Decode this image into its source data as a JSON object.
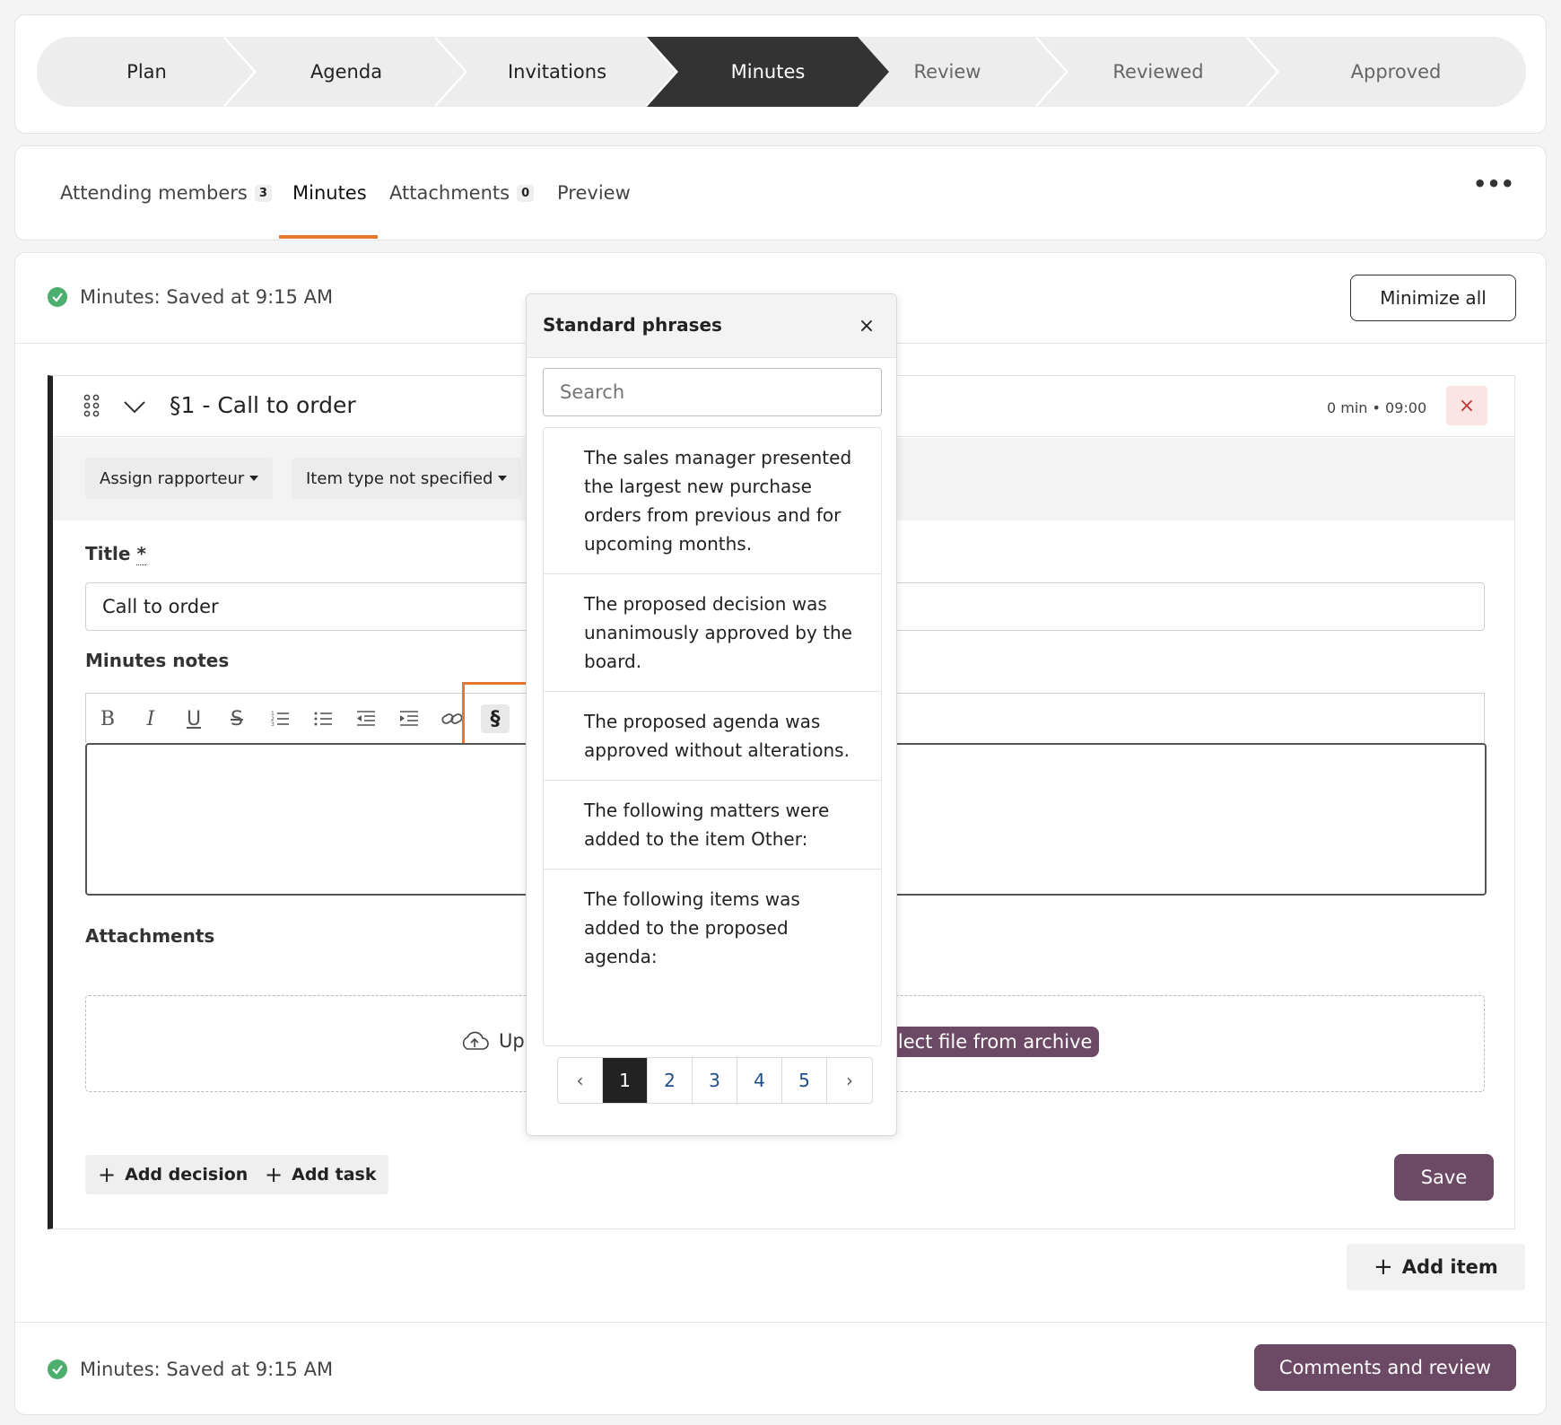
{
  "stepper": {
    "steps": [
      "Plan",
      "Agenda",
      "Invitations",
      "Minutes",
      "Review",
      "Reviewed",
      "Approved"
    ],
    "current": "Minutes"
  },
  "tabs": [
    {
      "label": "Attending members",
      "count": "3"
    },
    {
      "label": "Minutes"
    },
    {
      "label": "Attachments",
      "count": "0"
    },
    {
      "label": "Preview"
    }
  ],
  "tabs_more": "•••",
  "status": {
    "saved_text": "Minutes: Saved at 9:15 AM",
    "minimize_label": "Minimize all"
  },
  "item": {
    "title": "§1 - Call to order",
    "meta": "0 min • 09:00",
    "delete_icon": "×",
    "assign_label": "Assign rapporteur",
    "type_label": "Item type not specified",
    "title_label": "Title",
    "required_mark": "*",
    "title_value": "Call to order",
    "notes_label": "Minutes notes",
    "toolbar_icons": [
      "bold-icon",
      "italic-icon",
      "underline-icon",
      "strikethrough-icon",
      "ordered-list-icon",
      "bullet-list-icon",
      "outdent-icon",
      "indent-icon",
      "link-icon",
      "section-phrase-icon"
    ],
    "toolbar_glyphs": {
      "bold": "B",
      "italic": "I",
      "underline": "U",
      "strike": "S",
      "section": "§"
    },
    "attachments_label": "Attachments",
    "upload_text": "Up",
    "archive_text": "elect file from archive",
    "add_decision": "Add decision",
    "add_task": "Add task",
    "save_label": "Save"
  },
  "add_item_label": "Add item",
  "footer": {
    "saved_text": "Minutes: Saved at 9:15 AM",
    "review_label": "Comments and review"
  },
  "popover": {
    "title": "Standard phrases",
    "close": "×",
    "search_placeholder": "Search",
    "phrases": [
      "The sales manager presented the largest new purchase orders from previous and for upcoming months.",
      "The proposed decision was unanimously approved by the board.",
      "The proposed agenda was approved without alterations.",
      "The following matters were added to the item Other:",
      "The following items was added to the proposed agenda:"
    ],
    "pages": [
      "1",
      "2",
      "3",
      "4",
      "5"
    ],
    "current_page": "1",
    "prev": "‹",
    "next": "›"
  },
  "colors": {
    "accent_orange": "#e8772e",
    "brand_purple": "#6c4a66",
    "stepper_current": "#333333",
    "saved_check": "#4caf6e"
  }
}
